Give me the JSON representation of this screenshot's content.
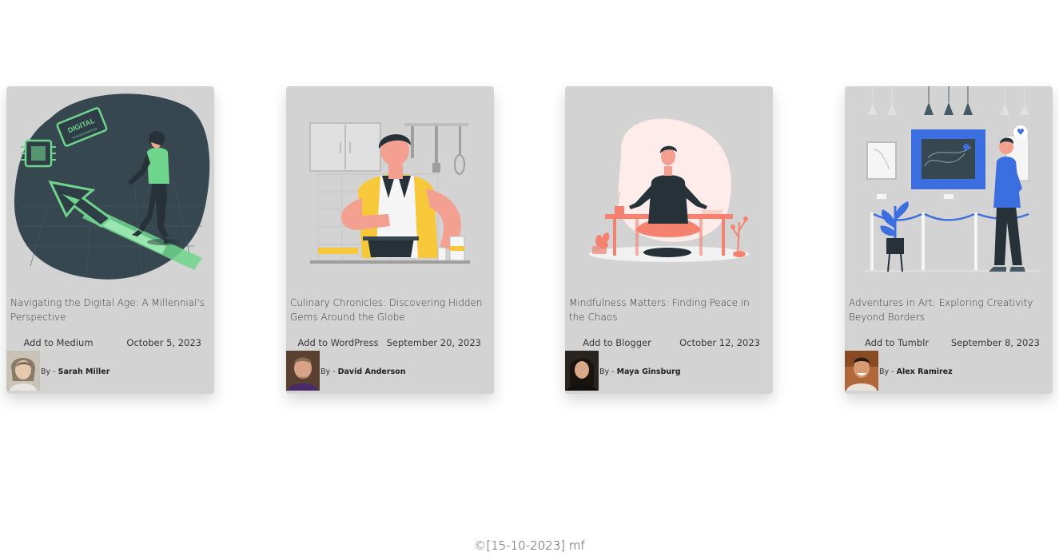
{
  "posts": [
    {
      "title": "Navigating the Digital Age: A Millennial's Perspective",
      "action": "Add to Medium",
      "date": "October 5, 2023",
      "by": "By - ",
      "author": "Sarah Miller",
      "illustration": "digital-transformation",
      "sign_text": "DIGITAL",
      "sign_subtext": "TRANSFORMATION",
      "accent": "#6fd58c"
    },
    {
      "title": "Culinary Chronicles: Discovering Hidden Gems Around the Globe",
      "action": "Add to WordPress",
      "date": "September 20, 2023",
      "by": "By - ",
      "author": "David Anderson",
      "illustration": "cooking",
      "accent": "#f6c83a"
    },
    {
      "title": "Mindfulness Matters: Finding Peace in the Chaos",
      "action": "Add to Blogger",
      "date": "October 12, 2023",
      "by": "By - ",
      "author": "Maya Ginsburg",
      "illustration": "meditation",
      "accent": "#f4826e"
    },
    {
      "title": "Adventures in Art: Exploring Creativity Beyond Borders",
      "action": "Add to Tumblr",
      "date": "September 8, 2023",
      "by": "By - ",
      "author": "Alex Ramirez",
      "illustration": "art-gallery",
      "accent": "#3b6fe0"
    }
  ],
  "footer": "©[15-10-2023] mf",
  "colors": {
    "card_bg": "#d3d3d3",
    "page_bg": "#ffffff"
  }
}
